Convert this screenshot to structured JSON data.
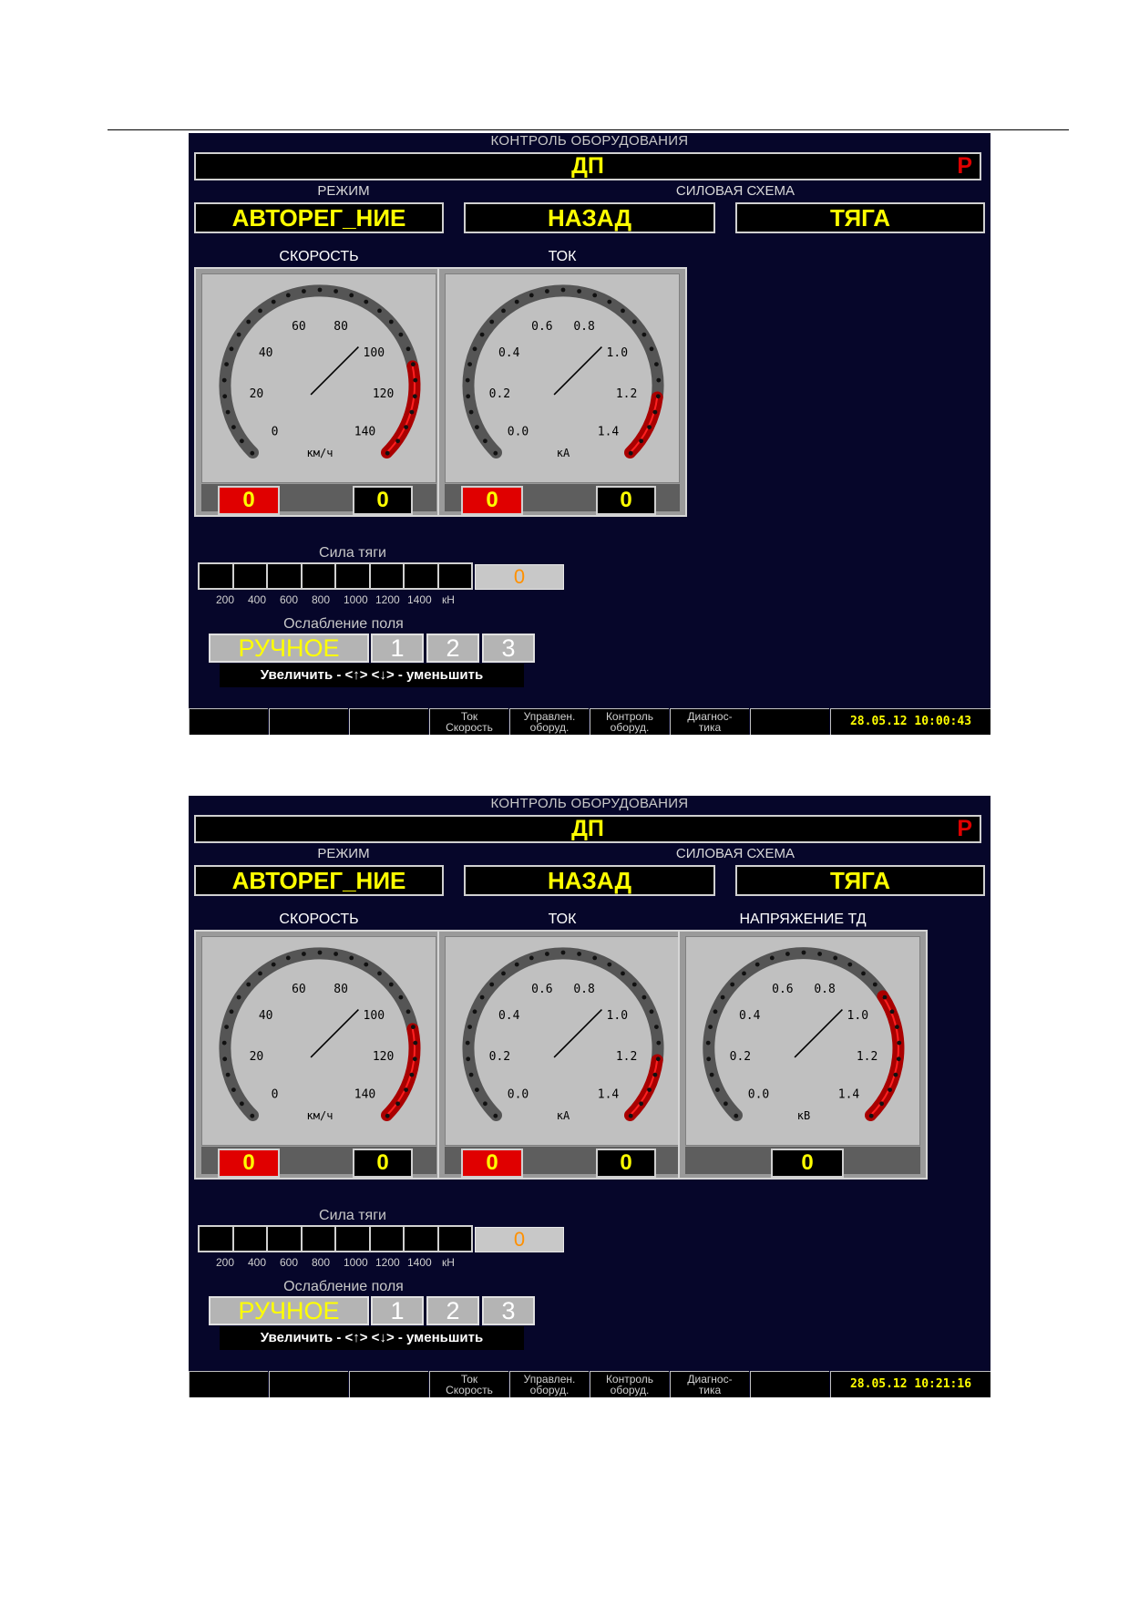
{
  "screens": [
    {
      "title": "КОНТРОЛЬ ОБОРУДОВАНИЯ",
      "header": {
        "main": "ДП",
        "flag": "Р"
      },
      "mode_label": "РЕЖИМ",
      "power_label": "СИЛОВАЯ СХЕМА",
      "mode": "АВТОРЕГ_НИЕ",
      "direction": "НАЗАД",
      "power_state": "ТЯГА",
      "gauges": [
        {
          "title": "СКОРОСТЬ",
          "unit": "км/ч",
          "ticks": [
            "0",
            "20",
            "40",
            "60",
            "80",
            "100",
            "120",
            "140"
          ],
          "red_from": 0.79,
          "value": 0,
          "value_red": "0",
          "value_black": "0"
        },
        {
          "title": "ТОК",
          "unit": "кА",
          "ticks": [
            "0.0",
            "0.2",
            "0.4",
            "0.6",
            "0.8",
            "1.0",
            "1.2",
            "1.4"
          ],
          "red_from": 0.86,
          "value": 0,
          "value_red": "0",
          "value_black": "0"
        }
      ],
      "traction": {
        "label": "Сила тяги",
        "value": "0",
        "ticks": [
          "200",
          "400",
          "600",
          "800",
          "1000",
          "1200",
          "1400",
          "кН"
        ]
      },
      "field_weakening": {
        "label": "Ослабление поля",
        "mode": "РУЧНОЕ",
        "steps": [
          "1",
          "2",
          "3"
        ],
        "hint": "Увеличить - <↑> <↓> - уменьшить"
      },
      "fkeys": [
        {
          "l1": "",
          "l2": ""
        },
        {
          "l1": "",
          "l2": ""
        },
        {
          "l1": "",
          "l2": ""
        },
        {
          "l1": "Ток",
          "l2": "Скорость"
        },
        {
          "l1": "Управлен.",
          "l2": "оборуд."
        },
        {
          "l1": "Контроль",
          "l2": "оборуд."
        },
        {
          "l1": "Диагнос-",
          "l2": "тика"
        },
        {
          "l1": "",
          "l2": ""
        }
      ],
      "clock": "28.05.12 10:00:43"
    },
    {
      "title": "КОНТРОЛЬ ОБОРУДОВАНИЯ",
      "header": {
        "main": "ДП",
        "flag": "Р"
      },
      "mode_label": "РЕЖИМ",
      "power_label": "СИЛОВАЯ СХЕМА",
      "mode": "АВТОРЕГ_НИЕ",
      "direction": "НАЗАД",
      "power_state": "ТЯГА",
      "gauges": [
        {
          "title": "СКОРОСТЬ",
          "unit": "км/ч",
          "ticks": [
            "0",
            "20",
            "40",
            "60",
            "80",
            "100",
            "120",
            "140"
          ],
          "red_from": 0.79,
          "value": 0,
          "value_red": "0",
          "value_black": "0"
        },
        {
          "title": "ТОК",
          "unit": "кА",
          "ticks": [
            "0.0",
            "0.2",
            "0.4",
            "0.6",
            "0.8",
            "1.0",
            "1.2",
            "1.4"
          ],
          "red_from": 0.86,
          "value": 0,
          "value_red": "0",
          "value_black": "0"
        },
        {
          "title": "НАПРЯЖЕНИЕ ТД",
          "unit": "кВ",
          "ticks": [
            "0.0",
            "0.2",
            "0.4",
            "0.6",
            "0.8",
            "1.0",
            "1.2",
            "1.4"
          ],
          "red_from": 0.71,
          "value": 0,
          "value_black": "0"
        }
      ],
      "traction": {
        "label": "Сила тяги",
        "value": "0",
        "ticks": [
          "200",
          "400",
          "600",
          "800",
          "1000",
          "1200",
          "1400",
          "кН"
        ]
      },
      "field_weakening": {
        "label": "Ослабление поля",
        "mode": "РУЧНОЕ",
        "steps": [
          "1",
          "2",
          "3"
        ],
        "hint": "Увеличить - <↑> <↓> - уменьшить"
      },
      "fkeys": [
        {
          "l1": "",
          "l2": ""
        },
        {
          "l1": "",
          "l2": ""
        },
        {
          "l1": "",
          "l2": ""
        },
        {
          "l1": "Ток",
          "l2": "Скорость"
        },
        {
          "l1": "Управлен.",
          "l2": "оборуд."
        },
        {
          "l1": "Контроль",
          "l2": "оборуд."
        },
        {
          "l1": "Диагнос-",
          "l2": "тика"
        },
        {
          "l1": "",
          "l2": ""
        }
      ],
      "clock": "28.05.12 10:21:16"
    }
  ],
  "colors": {
    "screen_bg": "#06062a",
    "accent_yellow": "#ffff00",
    "alarm_red": "#e00000",
    "arc_gray": "#555555",
    "arc_red": "#aa0000",
    "force_value": "#ff9000"
  }
}
